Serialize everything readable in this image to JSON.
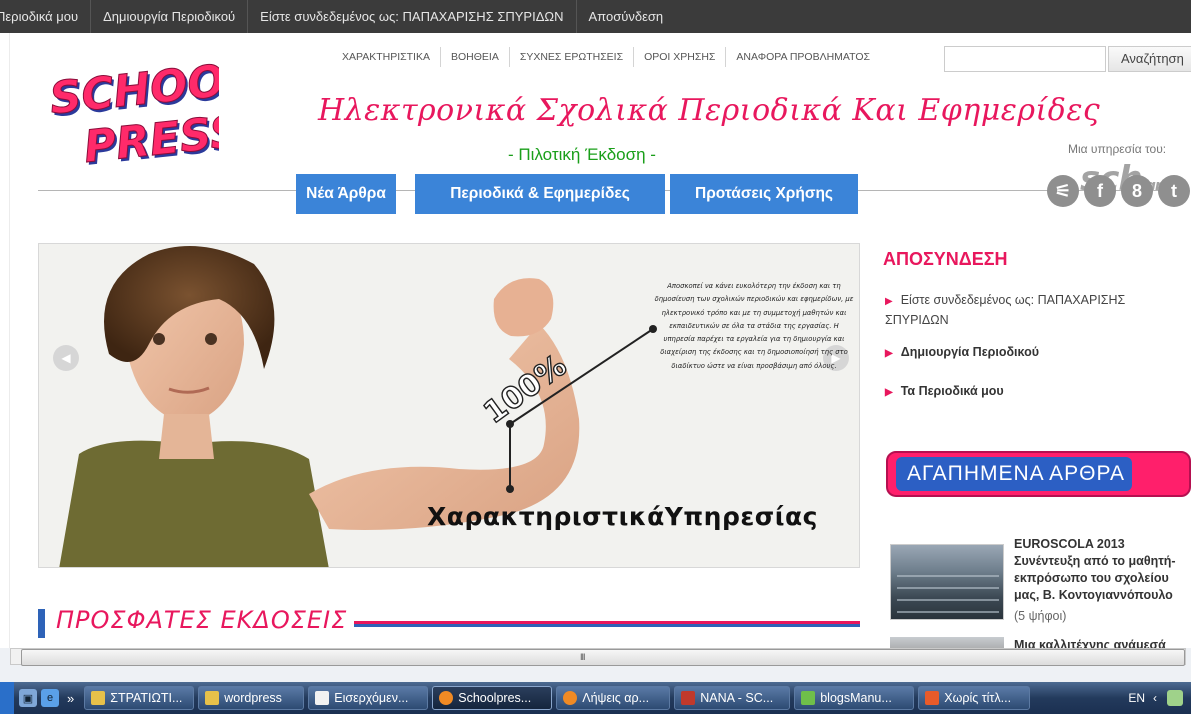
{
  "topbar": {
    "items": [
      "Περιοδικά μου",
      "Δημιουργία Περιοδικού",
      "Είστε συνδεδεμένος ως: ΠΑΠΑΧΑΡΙΣΗΣ ΣΠΥΡΙΔΩΝ",
      "Αποσύνδεση"
    ]
  },
  "header": {
    "nav_links": [
      "ΧΑΡΑΚΤΗΡΙΣΤΙΚΑ",
      "ΒΟΗΘΕΙΑ",
      "ΣΥΧΝΕΣ ΕΡΩΤΗΣΕΙΣ",
      "ΟΡΟΙ ΧΡΗΣΗΣ",
      "ΑΝΑΦΟΡΑ ΠΡΟΒΛΗΜΑΤΟΣ"
    ],
    "search_value": "",
    "search_button": "Αναζήτηση",
    "logo_line1": "SCHOOL",
    "logo_line2": "PRESS",
    "title": "Ηλεκτρονικά Σχολικά Περιοδικά Και Εφημερίδες",
    "subtitle": "- Πιλοτική Έκδοση -",
    "service_label": "Μια υπηρεσία του:",
    "service_logo": "sch",
    "service_logo_suffix": ".gr"
  },
  "mainnav": {
    "items": [
      "Νέα Άρθρα",
      "Περιοδικά & Εφημερίδες",
      "Προτάσεις Χρήσης"
    ]
  },
  "social": {
    "icons": [
      "rss-icon",
      "facebook-icon",
      "google-plus-icon",
      "twitter-icon"
    ],
    "glyphs": [
      "⚟",
      "f",
      "8",
      "t"
    ]
  },
  "slider": {
    "prev_glyph": "◀",
    "next_glyph": "▶",
    "percent": "100%",
    "caption": "ΧαρακτηριστικάΥπηρεσίας",
    "text": "Αποσκοπεί να κάνει ευκολότερη την έκδοση και τη δημοσίευση των σχολικών περιοδικών και εφημερίδων, με ηλεκτρονικό τρόπο και με τη συμμετοχή μαθητών και εκπαιδευτικών σε όλα τα στάδια της εργασίας. Η υπηρεσία παρέχει τα εργαλεία για τη δημιουργία και διαχείριση της έκδοσης και τη δημοσιοποίησή της στο διαδίκτυο ώστε να είναι προσβάσιμη από όλους."
  },
  "recent": {
    "title": "ΠΡΟΣΦΑΤΕΣ ΕΚΔΟΣΕΙΣ"
  },
  "sidebar": {
    "logout_title": "ΑΠΟΣΥΝΔΕΣΗ",
    "logged_in": "Είστε συνδεδεμένος ως: ΠΑΠΑΧΑΡΙΣΗΣ ΣΠΥΡΙΔΩΝ",
    "create_link": "Δημιουργία Περιοδικού",
    "my_link": "Τα Περιοδικά μου",
    "fav_title": "ΑΓΑΠΗΜΕΝΑ ΑΡΘΡΑ",
    "article1_title": "EUROSCOLA 2013 Συνέντευξη από το μαθητή-εκπρόσωπο του σχολείου μας, Β. Κοντογιαννόπουλο",
    "article1_votes": "(5 ψήφοι)",
    "article2_title": "Μια καλλιτέχνης ανάμεσά"
  },
  "scrollbar": {
    "grip": "III"
  },
  "taskbar": {
    "buttons": [
      "ΣΤΡΑΤΙΩΤΙ...",
      "wordpress",
      "Εισερχόμεν...",
      "Schoolpres...",
      "Λήψεις αρ...",
      "NANA - SC...",
      "blogsManu...",
      "Χωρίς τίτλ..."
    ],
    "lang": "EN",
    "chevron": "»"
  },
  "colors": {
    "accent_pink": "#e8175d",
    "nav_blue": "#3b84d8",
    "subtitle_green": "#1a9f1a",
    "topbar": "#3b3b3b"
  }
}
